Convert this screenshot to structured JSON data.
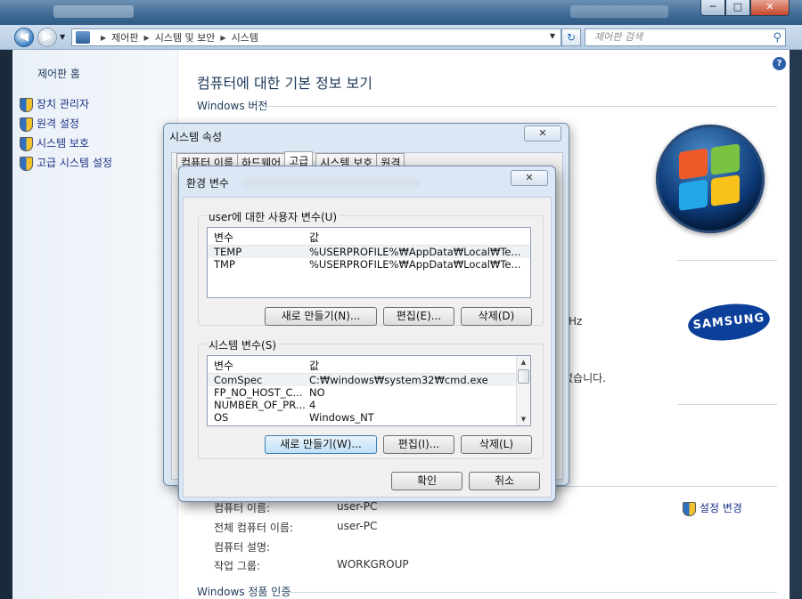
{
  "window": {
    "min_label": "─",
    "max_label": "□",
    "close_label": "✕"
  },
  "address": {
    "sep1": "▶",
    "crumb1": "제어판",
    "sep2": "▶",
    "crumb2": "시스템 및 보안",
    "sep3": "▶",
    "crumb3": "시스템",
    "search_placeholder": "제어판 검색"
  },
  "leftpane": {
    "home": "제어판 홈",
    "items": [
      {
        "label": "장치 관리자"
      },
      {
        "label": "원격 설정"
      },
      {
        "label": "시스템 보호"
      },
      {
        "label": "고급 시스템 설정"
      }
    ]
  },
  "main": {
    "title": "컴퓨터에 대한 기본 정보 보기",
    "edition_header": "Windows 버전",
    "activation_header": "Windows 정품 인증",
    "partial_hz": "Hz",
    "partial_none": "없습니다.",
    "computer_info": [
      {
        "label": "컴퓨터 이름:",
        "value": "user-PC"
      },
      {
        "label": "전체 컴퓨터 이름:",
        "value": "user-PC"
      },
      {
        "label": "컴퓨터 설명:",
        "value": ""
      },
      {
        "label": "작업 그룹:",
        "value": "WORKGROUP"
      }
    ],
    "change_settings": "설정 변경",
    "samsung_logo": "SAMSUNG"
  },
  "sysprop": {
    "title": "시스템 속성",
    "close_label": "✕",
    "tabs": [
      "컴퓨터 이름",
      "하드웨어",
      "고급",
      "시스템 보호",
      "원격"
    ]
  },
  "envdlg": {
    "title": "환경 변수",
    "close_label": "✕",
    "user_group_label": "user에 대한 사용자 변수(U)",
    "system_group_label": "시스템 변수(S)",
    "col_var": "변수",
    "col_val": "값",
    "user_vars": [
      {
        "name": "TEMP",
        "value": "%USERPROFILE%₩AppData₩Local₩Te..."
      },
      {
        "name": "TMP",
        "value": "%USERPROFILE%₩AppData₩Local₩Te..."
      }
    ],
    "system_vars": [
      {
        "name": "ComSpec",
        "value": "C:₩windows₩system32₩cmd.exe"
      },
      {
        "name": "FP_NO_HOST_C...",
        "value": "NO"
      },
      {
        "name": "NUMBER_OF_PR...",
        "value": "4"
      },
      {
        "name": "OS",
        "value": "Windows_NT"
      }
    ],
    "user_new": "새로 만들기(N)...",
    "user_edit": "편집(E)...",
    "user_delete": "삭제(D)",
    "sys_new": "새로 만들기(W)...",
    "sys_edit": "편집(I)...",
    "sys_delete": "삭제(L)",
    "ok": "확인",
    "cancel": "취소"
  }
}
